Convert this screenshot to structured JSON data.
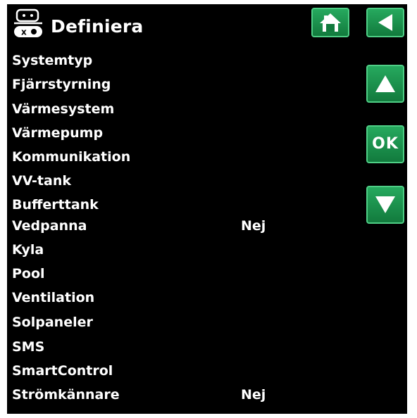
{
  "header": {
    "title": "Definiera",
    "icon": "settings-panel-icon"
  },
  "nav": {
    "home_icon": "home-icon",
    "back_icon": "back-arrow-icon",
    "up_icon": "up-arrow-icon",
    "ok_label": "OK",
    "down_icon": "down-arrow-icon",
    "button_color": "#1f9a53"
  },
  "menu": {
    "items": [
      {
        "label": "Systemtyp",
        "value": ""
      },
      {
        "label": "Fjärrstyrning",
        "value": ""
      },
      {
        "label": "Värmesystem",
        "value": ""
      },
      {
        "label": "Värmepump",
        "value": ""
      },
      {
        "label": "Kommunikation",
        "value": ""
      },
      {
        "label": "VV-tank",
        "value": ""
      },
      {
        "label": "Bufferttank",
        "value": ""
      },
      {
        "label": "Vedpanna",
        "value": "Nej"
      },
      {
        "label": "Kyla",
        "value": ""
      },
      {
        "label": "Pool",
        "value": ""
      },
      {
        "label": "Ventilation",
        "value": ""
      },
      {
        "label": "Solpaneler",
        "value": ""
      },
      {
        "label": "SMS",
        "value": ""
      },
      {
        "label": "SmartControl",
        "value": ""
      },
      {
        "label": "Strömkännare",
        "value": "Nej"
      }
    ]
  }
}
